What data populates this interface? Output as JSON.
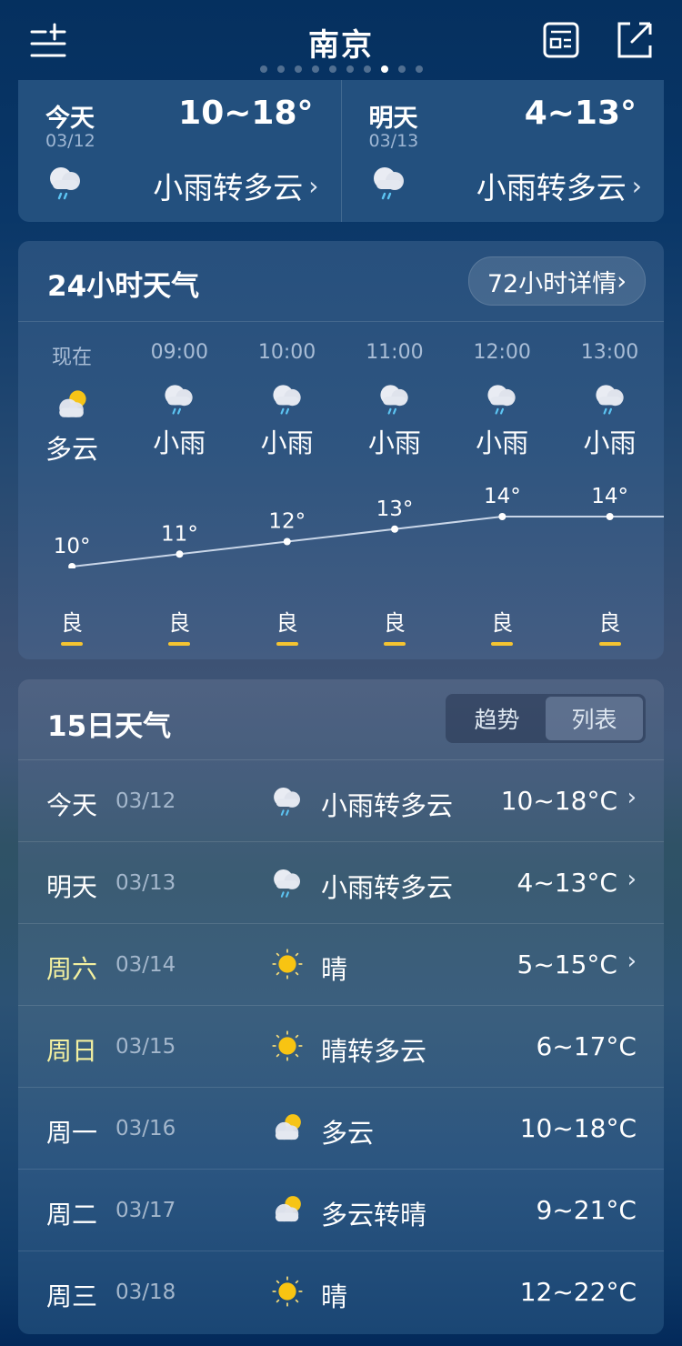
{
  "header": {
    "city": "南京",
    "page_count": 10,
    "active_page_index": 7,
    "icons": {
      "menu": "add-city-menu-icon",
      "news": "news-card-icon",
      "share": "share-icon"
    }
  },
  "today_tomorrow": [
    {
      "label": "今天",
      "date": "03/12",
      "temp": "10~18°",
      "condition": "小雨转多云",
      "icon": "light-rain"
    },
    {
      "label": "明天",
      "date": "03/13",
      "temp": "4~13°",
      "condition": "小雨转多云",
      "icon": "light-rain"
    }
  ],
  "hourly": {
    "title": "24小时天气",
    "detail_button": "72小时详情",
    "chevron": "›",
    "hours": [
      {
        "time": "现在",
        "condition": "多云",
        "icon": "partly-cloudy",
        "temp": "10°",
        "temp_value": 10,
        "aqi": "良"
      },
      {
        "time": "09:00",
        "condition": "小雨",
        "icon": "light-rain",
        "temp": "11°",
        "temp_value": 11,
        "aqi": "良"
      },
      {
        "time": "10:00",
        "condition": "小雨",
        "icon": "light-rain",
        "temp": "12°",
        "temp_value": 12,
        "aqi": "良"
      },
      {
        "time": "11:00",
        "condition": "小雨",
        "icon": "light-rain",
        "temp": "13°",
        "temp_value": 13,
        "aqi": "良"
      },
      {
        "time": "12:00",
        "condition": "小雨",
        "icon": "light-rain",
        "temp": "14°",
        "temp_value": 14,
        "aqi": "良"
      },
      {
        "time": "13:00",
        "condition": "小雨",
        "icon": "light-rain",
        "temp": "14°",
        "temp_value": 14,
        "aqi": "良"
      }
    ],
    "aqi_color": "#f5c431"
  },
  "daily": {
    "title": "15日天气",
    "toggle": {
      "options": [
        "趋势",
        "列表"
      ],
      "selected": "列表"
    },
    "weekend_color": "#f3f0a0",
    "days": [
      {
        "day": "今天",
        "date": "03/12",
        "condition": "小雨转多云",
        "icon": "light-rain",
        "temp": "10~18°C",
        "has_chevron": true,
        "weekend": false
      },
      {
        "day": "明天",
        "date": "03/13",
        "condition": "小雨转多云",
        "icon": "light-rain",
        "temp": "4~13°C",
        "has_chevron": true,
        "weekend": false
      },
      {
        "day": "周六",
        "date": "03/14",
        "condition": "晴",
        "icon": "sunny",
        "temp": "5~15°C",
        "has_chevron": true,
        "weekend": true
      },
      {
        "day": "周日",
        "date": "03/15",
        "condition": "晴转多云",
        "icon": "sunny",
        "temp": "6~17°C",
        "has_chevron": false,
        "weekend": true
      },
      {
        "day": "周一",
        "date": "03/16",
        "condition": "多云",
        "icon": "partly-cloudy",
        "temp": "10~18°C",
        "has_chevron": false,
        "weekend": false
      },
      {
        "day": "周二",
        "date": "03/17",
        "condition": "多云转晴",
        "icon": "partly-cloudy",
        "temp": "9~21°C",
        "has_chevron": false,
        "weekend": false
      },
      {
        "day": "周三",
        "date": "03/18",
        "condition": "晴",
        "icon": "sunny",
        "temp": "12~22°C",
        "has_chevron": false,
        "weekend": false
      }
    ]
  }
}
